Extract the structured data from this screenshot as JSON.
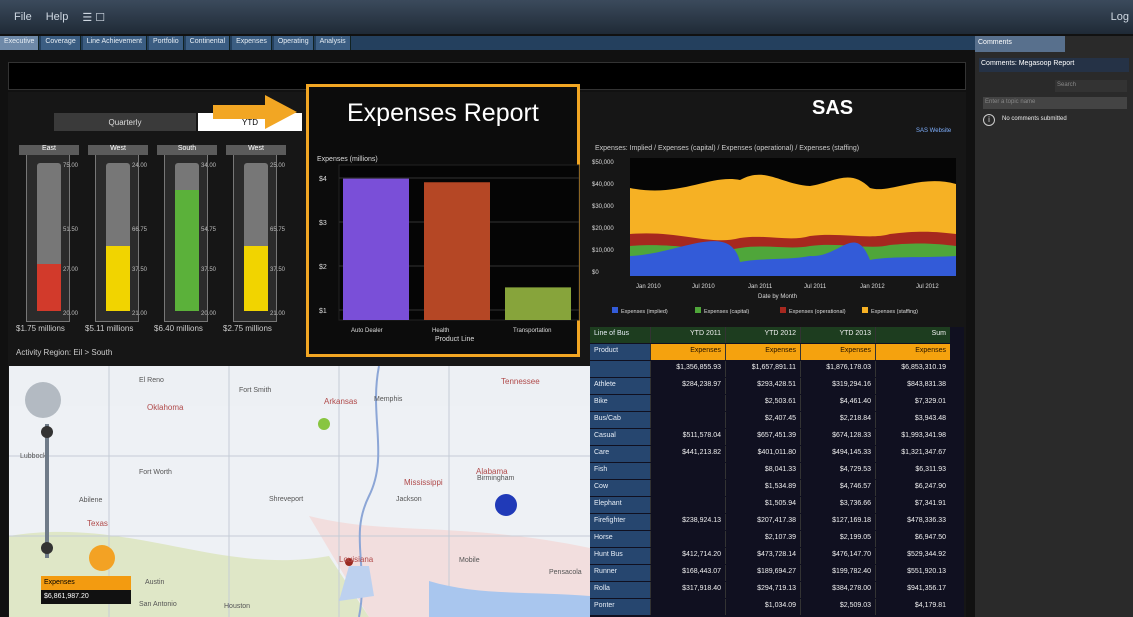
{
  "menubar": {
    "items": [
      "File",
      "Help"
    ],
    "right": "Log"
  },
  "tabs": [
    "Executive",
    "Coverage",
    "Line Achievement",
    "Portfolio",
    "Continental",
    "Expenses",
    "Operating",
    "Analysis"
  ],
  "gauges": {
    "tabs": [
      "Quarterly",
      "YTD"
    ],
    "regions": [
      {
        "name": "East",
        "top": "75.00",
        "mid": "51.50",
        "low": "27.00",
        "base": "20.00",
        "value": "$1.75 millions",
        "fill": 0.32,
        "color": "#d23a2b"
      },
      {
        "name": "West",
        "top": "24.00",
        "mid": "66.75",
        "low": "37.50",
        "base": "21.00",
        "value": "$5.11 millions",
        "fill": 0.44,
        "color": "#f1d400"
      },
      {
        "name": "South",
        "top": "34.00",
        "mid": "54.75",
        "low": "37.50",
        "base": "20.00",
        "value": "$6.40 millions",
        "fill": 0.82,
        "color": "#5bb13a"
      },
      {
        "name": "West",
        "top": "25.00",
        "mid": "65.75",
        "low": "37.50",
        "base": "21.00",
        "value": "$2.75 millions",
        "fill": 0.44,
        "color": "#f1d400"
      }
    ],
    "drill": "Activity Region: Eil > South"
  },
  "expenses": {
    "title": "Expenses Report",
    "ylabel": "Expenses (millions)",
    "xlabel": "Product Line",
    "yticks": [
      "$4",
      "$3",
      "$2",
      "$1"
    ],
    "bars": [
      {
        "name": "Auto Dealer",
        "value": 3.9,
        "color": "#7a4fd8"
      },
      {
        "name": "Health",
        "value": 3.8,
        "color": "#b54725"
      },
      {
        "name": "Transportation",
        "value": 0.9,
        "color": "#87a43b"
      }
    ]
  },
  "sas": {
    "logo": "SAS",
    "link": "SAS Website"
  },
  "area": {
    "title": "Expenses: Implied / Expenses (capital) / Expenses (operational) / Expenses (staffing)",
    "yticks": [
      "$50,000",
      "$40,000",
      "$30,000",
      "$20,000",
      "$10,000",
      "$0"
    ],
    "xticks": [
      "Jan 2010",
      "Jul 2010",
      "Jan 2011",
      "Jul 2011",
      "Jan 2012",
      "Jul 2012"
    ],
    "xlabel": "Date by Month",
    "legend": [
      "Expenses (implied)",
      "Expenses (capital)",
      "Expenses (operational)",
      "Expenses (staffing)"
    ]
  },
  "table": {
    "h1": [
      "Line of Bus",
      "YTD 2011",
      "YTD 2012",
      "YTD 2013",
      "Sum"
    ],
    "h2": [
      "Product",
      "Expenses",
      "Expenses",
      "Expenses",
      "Expenses"
    ],
    "rows": [
      [
        "",
        "$1,356,855.93",
        "$1,657,891.11",
        "$1,876,178.03",
        "$6,853,310.19"
      ],
      [
        "Athlete",
        "$284,238.97",
        "$293,428.51",
        "$319,294.16",
        "$843,831.38"
      ],
      [
        "Bike",
        "",
        "$2,503.61",
        "$4,461.40",
        "$7,329.01"
      ],
      [
        "Bus/Cab",
        "",
        "$2,407.45",
        "$2,218.84",
        "$3,943.48"
      ],
      [
        "Casual",
        "$511,578.04",
        "$657,451.39",
        "$674,128.33",
        "$1,993,341.98"
      ],
      [
        "Care",
        "$441,213.82",
        "$401,011.80",
        "$494,145.33",
        "$1,321,347.67"
      ],
      [
        "Fish",
        "",
        "$8,041.33",
        "$4,729.53",
        "$6,311.93"
      ],
      [
        "Cow",
        "",
        "$1,534.89",
        "$4,746.57",
        "$6,247.90"
      ],
      [
        "Elephant",
        "",
        "$1,505.94",
        "$3,736.66",
        "$7,341.91"
      ],
      [
        "Firefighter",
        "$238,924.13",
        "$207,417.38",
        "$127,169.18",
        "$478,336.33"
      ],
      [
        "Horse",
        "",
        "$2,107.39",
        "$2,199.05",
        "$6,947.50"
      ],
      [
        "Hunt Bus",
        "$412,714.20",
        "$473,728.14",
        "$476,147.70",
        "$529,344.92"
      ],
      [
        "Runner",
        "$168,443.07",
        "$189,694.27",
        "$199,782.40",
        "$551,920.13"
      ],
      [
        "Rolla",
        "$317,918.40",
        "$294,719.13",
        "$384,278.00",
        "$941,356.17"
      ],
      [
        "Ponter",
        "",
        "$1,034.09",
        "$2,509.03",
        "$4,179.81"
      ]
    ]
  },
  "map": {
    "slider": "Expenses",
    "value": "$6,861,987.20",
    "states": [
      "Texas",
      "Louisiana",
      "Mississippi",
      "Alabama",
      "Tennessee",
      "Arkansas",
      "Oklahoma"
    ],
    "cities": [
      "El Reno",
      "Fort Smith",
      "Memphis",
      "Fort Worth",
      "Shreveport",
      "Abilene",
      "Austin",
      "Houston",
      "San Antonio",
      "Mobile",
      "Pensacola",
      "Birmingham",
      "Jackson",
      "Lubbock"
    ]
  },
  "comments": {
    "tab": "Comments",
    "title": "Comments: Megasoop Report",
    "search": "Search",
    "placeholder": "Enter a topic name",
    "message": "No comments submitted"
  }
}
